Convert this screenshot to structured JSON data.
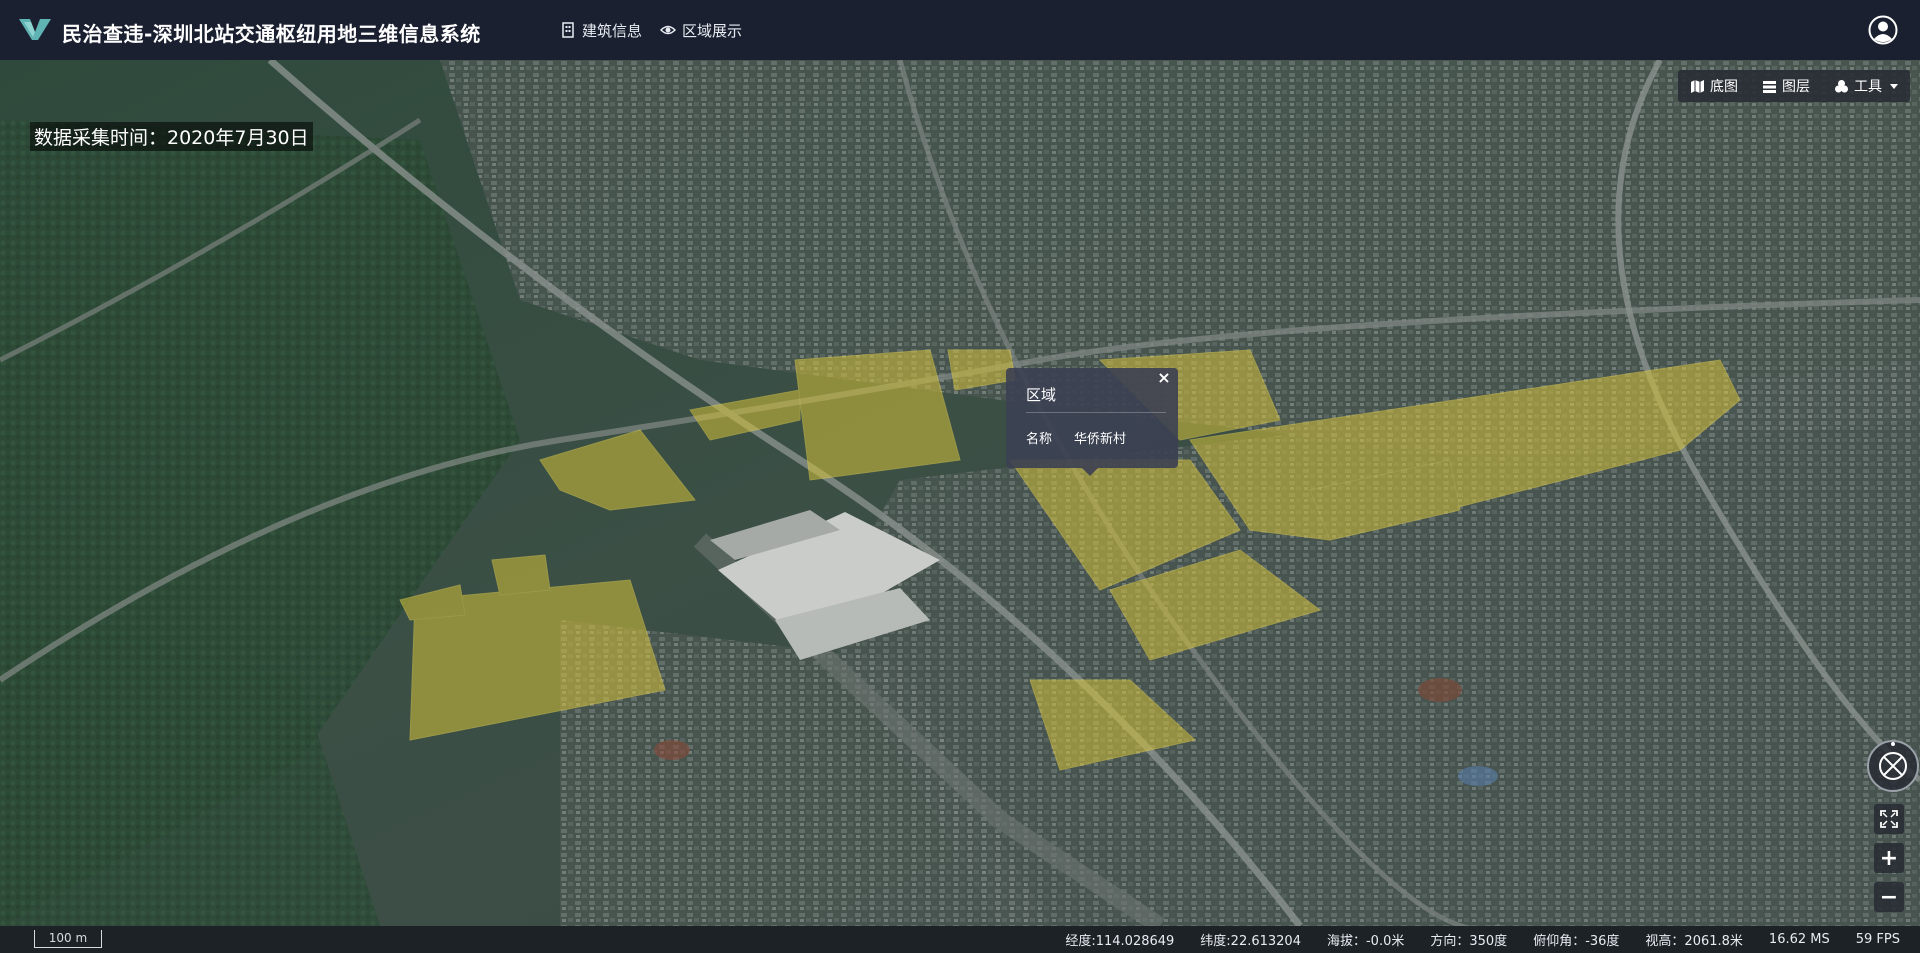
{
  "header": {
    "title": "民治查违-深圳北站交通枢纽用地三维信息系统",
    "nav": [
      {
        "label": "建筑信息",
        "icon": "building-icon"
      },
      {
        "label": "区域展示",
        "icon": "eye-icon"
      }
    ],
    "user_icon": "user-icon"
  },
  "capture_time": "数据采集时间：2020年7月30日",
  "toolbar": {
    "basemap": "底图",
    "layers": "图层",
    "tools": "工具"
  },
  "popup": {
    "title": "区域",
    "close": "×",
    "field_label": "名称",
    "field_value": "华侨新村"
  },
  "controls": {
    "zoom_in": "+",
    "zoom_out": "−"
  },
  "status": {
    "scale": "100 m",
    "longitude": "经度:114.028649",
    "latitude": "纬度:22.613204",
    "altitude": "海拔：-0.0米",
    "heading": "方向：350度",
    "pitch": "俯仰角：-36度",
    "view_height": "视高：2061.8米",
    "frame_time": "16.62 MS",
    "fps": "59 FPS"
  },
  "colors": {
    "header_bg": "#1b2030",
    "highlight_polygon": "#d4c13a",
    "panel_bg": "#282c34"
  }
}
